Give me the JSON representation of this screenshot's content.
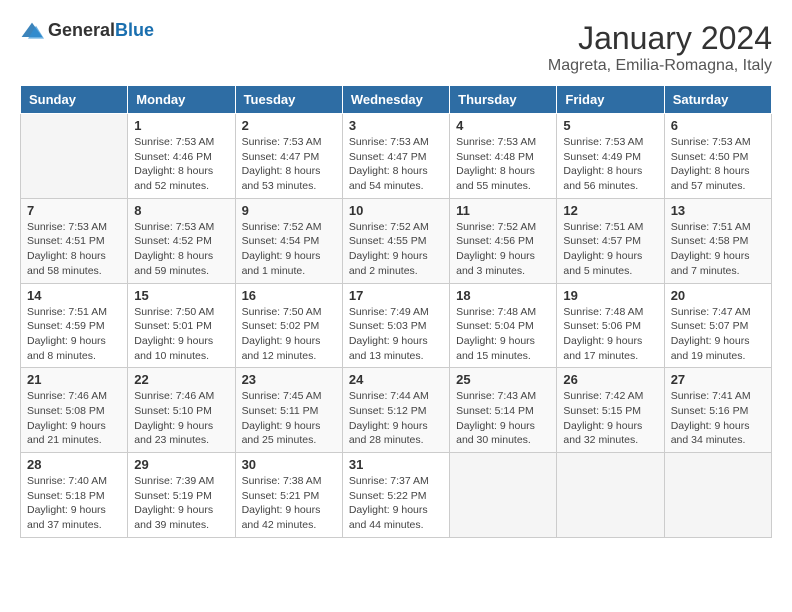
{
  "logo": {
    "general": "General",
    "blue": "Blue"
  },
  "title": "January 2024",
  "subtitle": "Magreta, Emilia-Romagna, Italy",
  "days_of_week": [
    "Sunday",
    "Monday",
    "Tuesday",
    "Wednesday",
    "Thursday",
    "Friday",
    "Saturday"
  ],
  "weeks": [
    [
      {
        "day": "",
        "info": ""
      },
      {
        "day": "1",
        "info": "Sunrise: 7:53 AM\nSunset: 4:46 PM\nDaylight: 8 hours\nand 52 minutes."
      },
      {
        "day": "2",
        "info": "Sunrise: 7:53 AM\nSunset: 4:47 PM\nDaylight: 8 hours\nand 53 minutes."
      },
      {
        "day": "3",
        "info": "Sunrise: 7:53 AM\nSunset: 4:47 PM\nDaylight: 8 hours\nand 54 minutes."
      },
      {
        "day": "4",
        "info": "Sunrise: 7:53 AM\nSunset: 4:48 PM\nDaylight: 8 hours\nand 55 minutes."
      },
      {
        "day": "5",
        "info": "Sunrise: 7:53 AM\nSunset: 4:49 PM\nDaylight: 8 hours\nand 56 minutes."
      },
      {
        "day": "6",
        "info": "Sunrise: 7:53 AM\nSunset: 4:50 PM\nDaylight: 8 hours\nand 57 minutes."
      }
    ],
    [
      {
        "day": "7",
        "info": "Sunrise: 7:53 AM\nSunset: 4:51 PM\nDaylight: 8 hours\nand 58 minutes."
      },
      {
        "day": "8",
        "info": "Sunrise: 7:53 AM\nSunset: 4:52 PM\nDaylight: 8 hours\nand 59 minutes."
      },
      {
        "day": "9",
        "info": "Sunrise: 7:52 AM\nSunset: 4:54 PM\nDaylight: 9 hours\nand 1 minute."
      },
      {
        "day": "10",
        "info": "Sunrise: 7:52 AM\nSunset: 4:55 PM\nDaylight: 9 hours\nand 2 minutes."
      },
      {
        "day": "11",
        "info": "Sunrise: 7:52 AM\nSunset: 4:56 PM\nDaylight: 9 hours\nand 3 minutes."
      },
      {
        "day": "12",
        "info": "Sunrise: 7:51 AM\nSunset: 4:57 PM\nDaylight: 9 hours\nand 5 minutes."
      },
      {
        "day": "13",
        "info": "Sunrise: 7:51 AM\nSunset: 4:58 PM\nDaylight: 9 hours\nand 7 minutes."
      }
    ],
    [
      {
        "day": "14",
        "info": "Sunrise: 7:51 AM\nSunset: 4:59 PM\nDaylight: 9 hours\nand 8 minutes."
      },
      {
        "day": "15",
        "info": "Sunrise: 7:50 AM\nSunset: 5:01 PM\nDaylight: 9 hours\nand 10 minutes."
      },
      {
        "day": "16",
        "info": "Sunrise: 7:50 AM\nSunset: 5:02 PM\nDaylight: 9 hours\nand 12 minutes."
      },
      {
        "day": "17",
        "info": "Sunrise: 7:49 AM\nSunset: 5:03 PM\nDaylight: 9 hours\nand 13 minutes."
      },
      {
        "day": "18",
        "info": "Sunrise: 7:48 AM\nSunset: 5:04 PM\nDaylight: 9 hours\nand 15 minutes."
      },
      {
        "day": "19",
        "info": "Sunrise: 7:48 AM\nSunset: 5:06 PM\nDaylight: 9 hours\nand 17 minutes."
      },
      {
        "day": "20",
        "info": "Sunrise: 7:47 AM\nSunset: 5:07 PM\nDaylight: 9 hours\nand 19 minutes."
      }
    ],
    [
      {
        "day": "21",
        "info": "Sunrise: 7:46 AM\nSunset: 5:08 PM\nDaylight: 9 hours\nand 21 minutes."
      },
      {
        "day": "22",
        "info": "Sunrise: 7:46 AM\nSunset: 5:10 PM\nDaylight: 9 hours\nand 23 minutes."
      },
      {
        "day": "23",
        "info": "Sunrise: 7:45 AM\nSunset: 5:11 PM\nDaylight: 9 hours\nand 25 minutes."
      },
      {
        "day": "24",
        "info": "Sunrise: 7:44 AM\nSunset: 5:12 PM\nDaylight: 9 hours\nand 28 minutes."
      },
      {
        "day": "25",
        "info": "Sunrise: 7:43 AM\nSunset: 5:14 PM\nDaylight: 9 hours\nand 30 minutes."
      },
      {
        "day": "26",
        "info": "Sunrise: 7:42 AM\nSunset: 5:15 PM\nDaylight: 9 hours\nand 32 minutes."
      },
      {
        "day": "27",
        "info": "Sunrise: 7:41 AM\nSunset: 5:16 PM\nDaylight: 9 hours\nand 34 minutes."
      }
    ],
    [
      {
        "day": "28",
        "info": "Sunrise: 7:40 AM\nSunset: 5:18 PM\nDaylight: 9 hours\nand 37 minutes."
      },
      {
        "day": "29",
        "info": "Sunrise: 7:39 AM\nSunset: 5:19 PM\nDaylight: 9 hours\nand 39 minutes."
      },
      {
        "day": "30",
        "info": "Sunrise: 7:38 AM\nSunset: 5:21 PM\nDaylight: 9 hours\nand 42 minutes."
      },
      {
        "day": "31",
        "info": "Sunrise: 7:37 AM\nSunset: 5:22 PM\nDaylight: 9 hours\nand 44 minutes."
      },
      {
        "day": "",
        "info": ""
      },
      {
        "day": "",
        "info": ""
      },
      {
        "day": "",
        "info": ""
      }
    ]
  ]
}
